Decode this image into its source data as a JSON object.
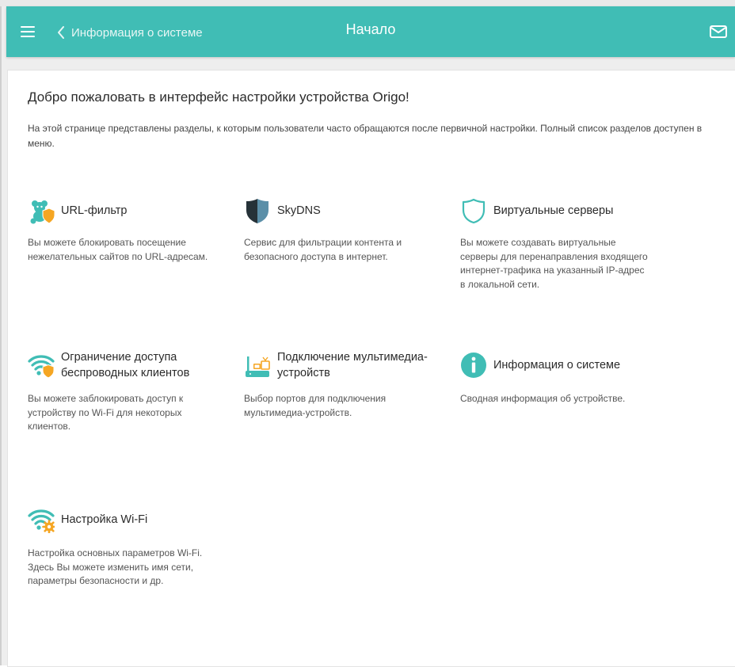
{
  "header": {
    "back_label": "Информация о системе",
    "title": "Начало",
    "icons": [
      "menu-icon",
      "chevron-left-icon",
      "mail-icon"
    ],
    "color": "#40bdb5"
  },
  "main": {
    "welcome": "Добро пожаловать в интерфейс настройки устройства Origo!",
    "intro": "На этой странице представлены разделы, к которым пользователи часто обращаются после первичной настройки. Полный список разделов доступен в меню.",
    "cards": [
      {
        "icon": "url-filter-icon",
        "title": "URL-фильтр",
        "desc": "Вы можете блокировать посещение нежелательных сайтов по URL-адресам."
      },
      {
        "icon": "skydns-shield-icon",
        "title": "SkyDNS",
        "desc": "Сервис для фильтрации контента и безопасного доступа в интернет."
      },
      {
        "icon": "shield-outline-icon",
        "title": "Виртуальные серверы",
        "desc": "Вы можете создавать виртуальные серверы для перенаправления входящего интернет-трафика на указанный IP-адрес в локальной сети."
      },
      {
        "icon": "wifi-shield-icon",
        "title": "Ограничение доступа беспроводных клиентов",
        "desc": "Вы можете заблокировать доступ к устройству по Wi-Fi для некоторых клиентов."
      },
      {
        "icon": "multimedia-devices-icon",
        "title": "Подключение мультимедиа-устройств",
        "desc": "Выбор портов для подключения мультимедиа-устройств."
      },
      {
        "icon": "info-icon",
        "title": "Информация о системе",
        "desc": "Сводная информация об устройстве."
      },
      {
        "icon": "wifi-gear-icon",
        "title": "Настройка Wi-Fi",
        "desc": "Настройка основных параметров Wi-Fi. Здесь Вы можете изменить имя сети, параметры безопасности и др."
      }
    ]
  },
  "colors": {
    "accent": "#40bdb5",
    "orange": "#f5a623",
    "dark": "#263238",
    "steel": "#5b8fa8"
  }
}
